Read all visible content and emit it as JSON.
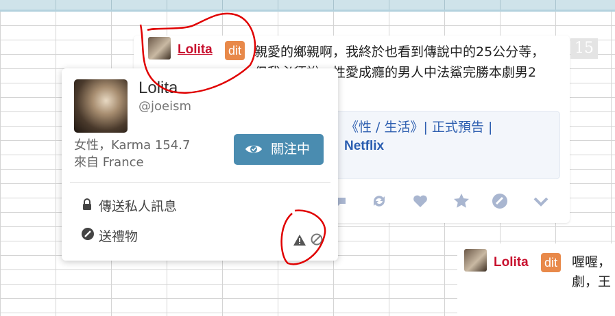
{
  "post": {
    "username": "Lolita",
    "badge": "dit",
    "text": "親愛的鄉親啊，我終於也看到傳說中的25公分䓁，但我必須說，性愛成癮的男人中法鯊完勝本劇男2",
    "count": "15",
    "link_line1": "《性 / 生活》| 正式預告 |",
    "link_line2": "Netflix",
    "action_icons": [
      "comment-icon",
      "repost-icon",
      "heart-icon",
      "star-icon",
      "gift-icon",
      "chevron-down-icon"
    ]
  },
  "popup": {
    "name": "Lolita",
    "handle": "@joeism",
    "meta_line1": "女性，Karma 154.7",
    "meta_line2": "來自 France",
    "follow_label": "關注中",
    "menu": [
      {
        "icon": "lock-icon",
        "label": "傳送私人訊息"
      },
      {
        "icon": "gift-icon",
        "label": "送禮物"
      }
    ],
    "report_icon": "warning-icon",
    "block_icon": "block-icon"
  },
  "post2": {
    "username": "Lolita",
    "badge": "dit",
    "text": "喔喔，劇，王"
  },
  "colors": {
    "username": "#c8102e",
    "badge": "#e8894a",
    "follow_button": "#4a8cb0",
    "link": "#2e5fb0",
    "annotation": "#e00000"
  }
}
